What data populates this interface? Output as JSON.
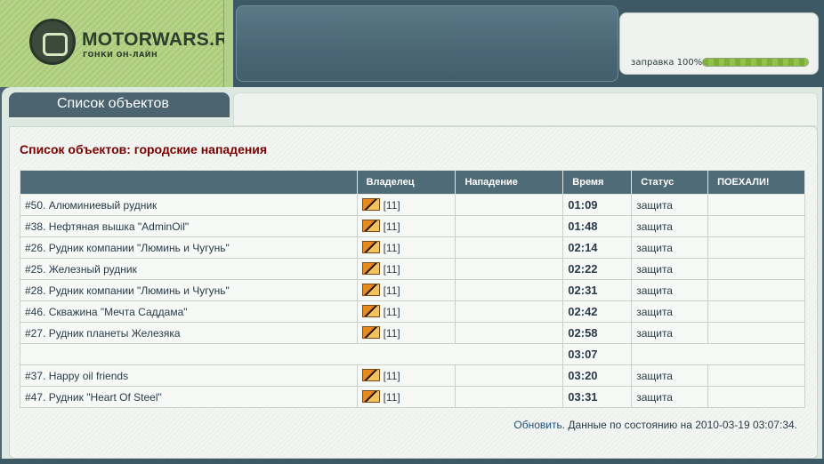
{
  "brand": {
    "name": "MOTORWARS.RU",
    "tagline": "ГОНКИ ОН-ЛАЙН"
  },
  "fuel": {
    "label": "заправка 100%",
    "level": 1.0
  },
  "tab": {
    "label": "Список объектов"
  },
  "page": {
    "heading": "Список объектов: городские нападения"
  },
  "table": {
    "headers": {
      "owner": "Владелец",
      "attack": "Нападение",
      "time": "Время",
      "status": "Статус",
      "go": "ПОЕХАЛИ!"
    },
    "rows": [
      {
        "name": "#50. Алюминиевый рудник",
        "owner": "[11]",
        "attack": "",
        "time": "01:09",
        "status": "защита",
        "go": ""
      },
      {
        "name": "#38. Нефтяная вышка \"AdminOil\"",
        "owner": "[11]",
        "attack": "",
        "time": "01:48",
        "status": "защита",
        "go": ""
      },
      {
        "name": "#26. Рудник компании \"Люминь и Чугунь\"",
        "owner": "[11]",
        "attack": "",
        "time": "02:14",
        "status": "защита",
        "go": ""
      },
      {
        "name": "#25. Железный рудник",
        "owner": "[11]",
        "attack": "",
        "time": "02:22",
        "status": "защита",
        "go": ""
      },
      {
        "name": "#28. Рудник компании \"Люминь и Чугунь\"",
        "owner": "[11]",
        "attack": "",
        "time": "02:31",
        "status": "защита",
        "go": ""
      },
      {
        "name": "#46. Скважина \"Мечта Саддама\"",
        "owner": "[11]",
        "attack": "",
        "time": "02:42",
        "status": "защита",
        "go": ""
      },
      {
        "name": "#27. Рудник планеты Железяка",
        "owner": "[11]",
        "attack": "",
        "time": "02:58",
        "status": "защита",
        "go": ""
      }
    ],
    "current_time": "03:07",
    "rows_after": [
      {
        "name": "#37. Happy oil friends",
        "owner": "[11]",
        "attack": "",
        "time": "03:20",
        "status": "защита",
        "go": ""
      },
      {
        "name": "#47. Рудник \"Heart Of Steel\"",
        "owner": "[11]",
        "attack": "",
        "time": "03:31",
        "status": "защита",
        "go": ""
      }
    ]
  },
  "footer": {
    "refresh_label": "Обновить",
    "status_text": ". Данные по состоянию на 2010-03-19 03:07:34."
  }
}
